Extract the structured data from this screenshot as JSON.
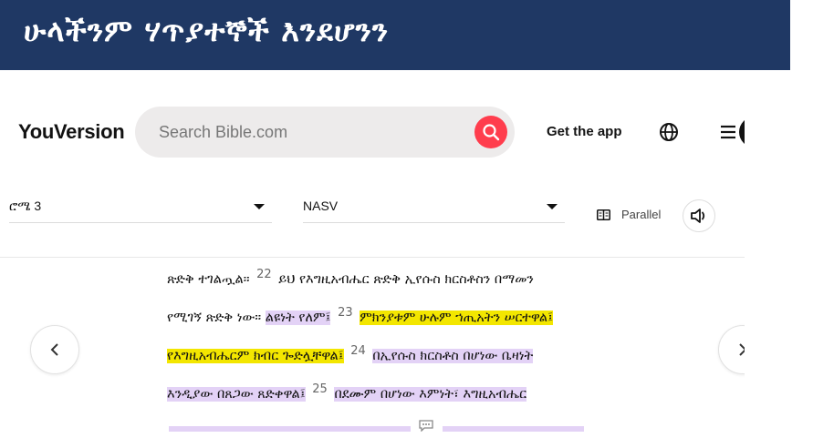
{
  "banner": {
    "title": "ሁላችንም ሃጥያተኞች እንደሆንን",
    "color": "#1f3864"
  },
  "header": {
    "logo": "YouVersion",
    "search_placeholder": "Search Bible.com",
    "get_app": "Get the app",
    "icons": [
      "search-icon",
      "globe-icon",
      "menu-icon"
    ],
    "accent_color": "#ff3d4d"
  },
  "controls": {
    "book_chapter": "ሮሜ 3",
    "version": "NASV",
    "parallel_label": "Parallel",
    "audio_icon": "speaker-icon"
  },
  "reader": {
    "lines": [
      [
        {
          "text": "ጽድቅ ተገልጧል።",
          "hl": ""
        },
        {
          "verse": "22"
        },
        {
          "text": "ይህ የእግዚአብሔር ጽድቅ ኢየሱስ ክርስቶስን በማመን",
          "hl": ""
        }
      ],
      [
        {
          "text": "የሚገኝ ጽድቅ ነው።",
          "hl": ""
        },
        {
          "text": "ልዩነት የለም፤",
          "hl": "purple"
        },
        {
          "verse": "23"
        },
        {
          "text": "ምክንያቱም ሁሉም ኀጢአትን ሠርተዋል፤",
          "hl": "yellow"
        }
      ],
      [
        {
          "text": "የእግዚአብሔርም ክብር ጐድሏቸዋል፤",
          "hl": "yellow"
        },
        {
          "verse": "24"
        },
        {
          "text": "በኢየሱስ ክርስቶስ በሆነው ቤዛነት",
          "hl": "purple"
        }
      ],
      [
        {
          "text": "እንዲያው በጸጋው ጸድቀዋል፤",
          "hl": "purple"
        },
        {
          "verse": "25"
        },
        {
          "text": "በደሙም በሆነው እምነት፣ እግዚአብሔር",
          "hl": "purple"
        }
      ]
    ],
    "highlight_colors": {
      "purple": "#e3d2f6",
      "yellow": "#f3e600"
    }
  },
  "nav": {
    "prev_icon": "chevron-left-icon",
    "next_icon": "chevron-right-icon"
  }
}
